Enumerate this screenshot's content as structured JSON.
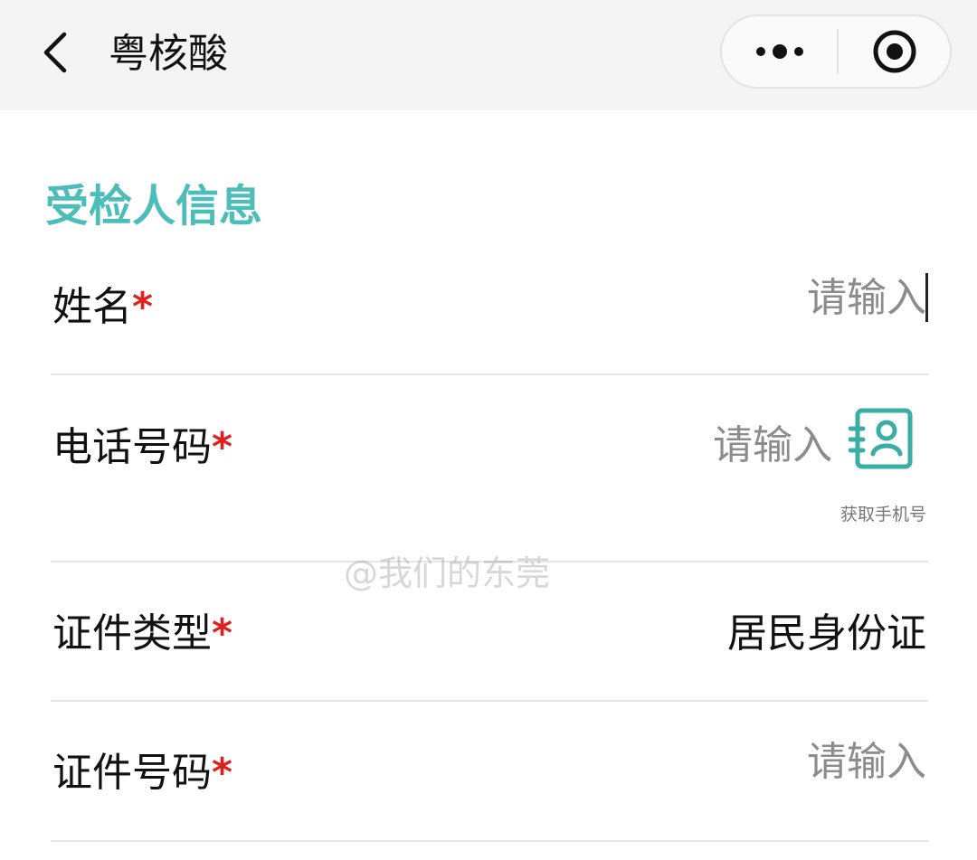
{
  "navbar": {
    "title": "粤核酸",
    "back_icon": "chevron-left-icon",
    "more_icon": "more-dots-icon",
    "close_icon": "target-close-icon"
  },
  "section": {
    "title": "受检人信息"
  },
  "fields": {
    "name": {
      "label": "姓名",
      "required": "*",
      "placeholder": "请输入",
      "value": ""
    },
    "phone": {
      "label": "电话号码",
      "required": "*",
      "placeholder": "请输入",
      "value": "",
      "contact_icon": "contact-card-icon",
      "get_phone_label": "获取手机号"
    },
    "id_type": {
      "label": "证件类型",
      "required": "*",
      "value": "居民身份证"
    },
    "id_number": {
      "label": "证件号码",
      "required": "*",
      "placeholder": "请输入",
      "value": ""
    }
  },
  "watermark": "@我们的东莞",
  "colors": {
    "accent": "#4dbdb9",
    "required": "#e02020",
    "navbar_bg": "#f4f4f4",
    "placeholder": "#8c8c8c"
  }
}
